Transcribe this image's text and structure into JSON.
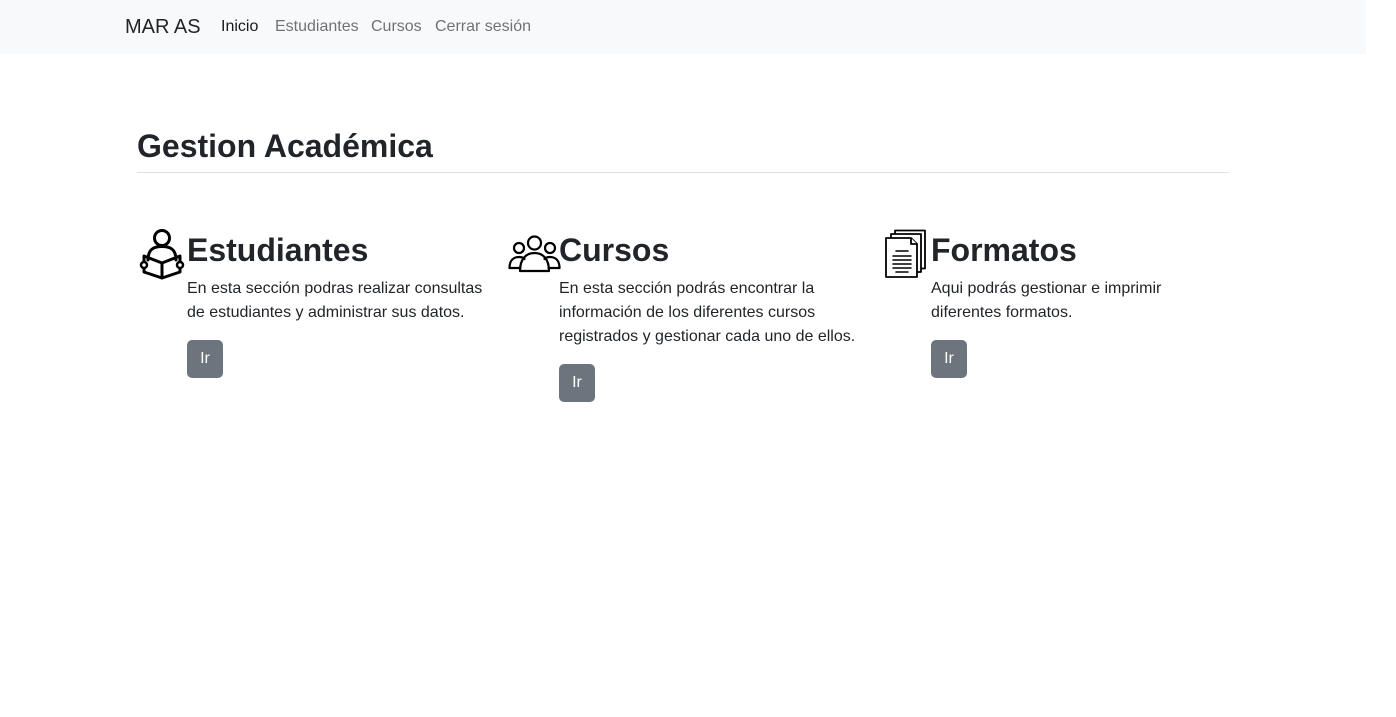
{
  "navbar": {
    "brand": "MAR AS",
    "links": [
      {
        "label": "Inicio",
        "active": true
      },
      {
        "label": "Estudiantes",
        "active": false
      },
      {
        "label": "Cursos",
        "active": false
      },
      {
        "label": "Cerrar sesión",
        "active": false
      }
    ]
  },
  "main": {
    "title": "Gestion Académica",
    "cards": [
      {
        "title": "Estudiantes",
        "icon": "student-reading-icon",
        "text_lines": [
          "En esta sección podras realizar consultas",
          "de estudiantes y administrar sus datos."
        ],
        "button": "Ir"
      },
      {
        "title": "Cursos",
        "icon": "people-group-icon",
        "text_lines": [
          "En esta sección podrás encontrar la",
          "información de los diferentes cursos",
          "registrados y gestionar cada uno de ellos."
        ],
        "button": "Ir"
      },
      {
        "title": "Formatos",
        "icon": "documents-icon",
        "text_lines": [
          "Aqui podrás gestionar e imprimir",
          "diferentes formatos."
        ],
        "button": "Ir"
      }
    ]
  },
  "colors": {
    "navbar_bg": "#f8f9fa",
    "button_bg": "#6c757d",
    "text": "#212529"
  }
}
